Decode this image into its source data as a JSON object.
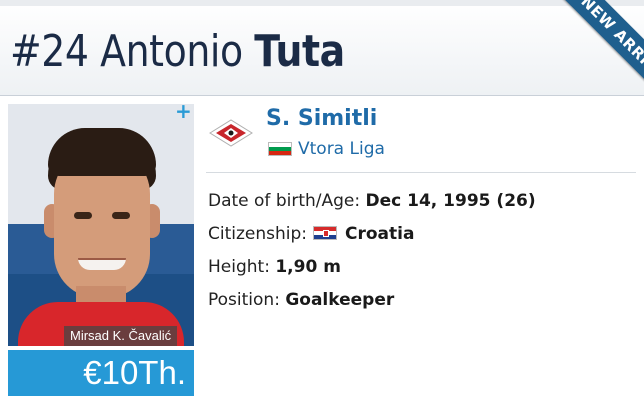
{
  "player": {
    "number": "#24",
    "first_name": "Antonio",
    "last_name": "Tuta",
    "market_value": "€10Th.",
    "photo_credit": "Mirsad K. Čavalić",
    "badge": "NEW ARRIVAL"
  },
  "club": {
    "name": "S. Simitli",
    "league": "Vtora Liga",
    "league_flag_icon": "bulgaria-flag-icon",
    "logo_icon": "club-crest-icon"
  },
  "details": {
    "dob_label": "Date of birth/Age:",
    "dob_value": "Dec 14, 1995 (26)",
    "citizenship_label": "Citizenship:",
    "citizenship_value": "Croatia",
    "citizenship_flag_icon": "croatia-flag-icon",
    "height_label": "Height:",
    "height_value": "1,90 m",
    "position_label": "Position:",
    "position_value": "Goalkeeper"
  },
  "colors": {
    "accent_blue": "#2699d6",
    "link_blue": "#1f6ba8",
    "ribbon": "#1f5f8e",
    "title_navy": "#1b2b46"
  }
}
